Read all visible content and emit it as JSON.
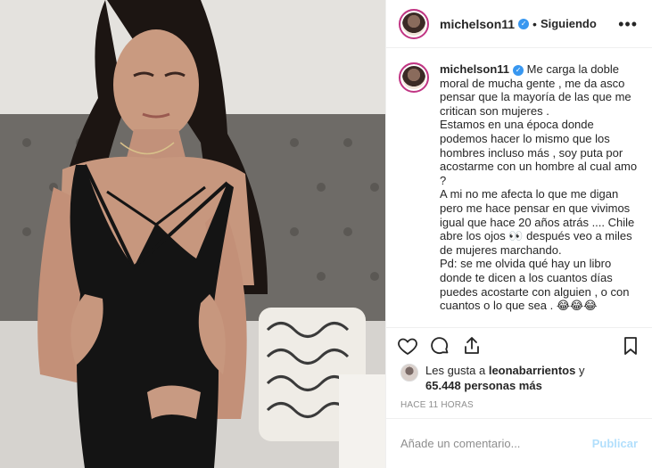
{
  "post": {
    "image_alt": "Foto de la publicación",
    "author": {
      "username": "michelson11",
      "verified": true,
      "follow_status": "Siguiendo",
      "separator": "•"
    },
    "more_options_label": "•••",
    "caption_lines": [
      "Me carga la doble moral de mucha gente , me da asco pensar que la mayoría de las que me critican son mujeres .",
      "Estamos en una época donde podemos hacer lo mismo que los hombres incluso más , soy puta por acostarme con un hombre al cual amo ?",
      "A mi no me afecta lo que me digan pero me hace pensar en que vivimos igual que hace 20 años atrás .... Chile abre los ojos 👀 después veo a miles de mujeres marchando.",
      "Pd: se me olvida qué hay un libro donde te dicen a los cuantos días puedes acostarte con alguien , o con cuantos o lo que sea . 😂😂😂"
    ],
    "actions": {
      "like_icon": "heart-icon",
      "comment_icon": "comment-icon",
      "share_icon": "share-icon",
      "save_icon": "bookmark-icon"
    },
    "likes": {
      "prefix": "Les gusta a ",
      "liker": "leonabarrientos",
      "connector": " y",
      "count": "65.448 personas más"
    },
    "timestamp": "Hace 11 horas",
    "comment_box": {
      "placeholder": "Añade un comentario...",
      "publish_label": "Publicar"
    }
  },
  "colors": {
    "verified_blue": "#3897f0",
    "publish_disabled": "#b2dffc",
    "muted_text": "#8e8e8e",
    "border": "#efefef"
  }
}
